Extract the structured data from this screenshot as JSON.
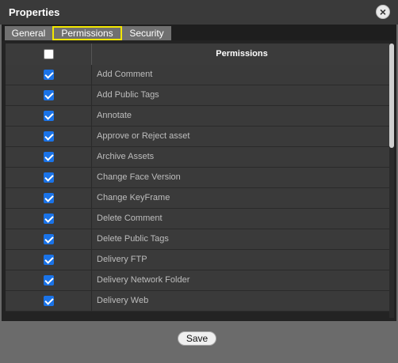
{
  "dialog": {
    "title": "Properties",
    "close_label": "×",
    "tabs": [
      {
        "label": "General"
      },
      {
        "label": "Permissions",
        "selected": true
      },
      {
        "label": "Security"
      }
    ]
  },
  "table": {
    "select_all_checked": false,
    "column_header": "Permissions",
    "rows": [
      {
        "label": "Add Comment",
        "checked": true
      },
      {
        "label": "Add Public Tags",
        "checked": true
      },
      {
        "label": "Annotate",
        "checked": true
      },
      {
        "label": "Approve or Reject asset",
        "checked": true
      },
      {
        "label": "Archive Assets",
        "checked": true
      },
      {
        "label": "Change Face Version",
        "checked": true
      },
      {
        "label": "Change KeyFrame",
        "checked": true
      },
      {
        "label": "Delete Comment",
        "checked": true
      },
      {
        "label": "Delete Public Tags",
        "checked": true
      },
      {
        "label": "Delivery FTP",
        "checked": true
      },
      {
        "label": "Delivery Network Folder",
        "checked": true
      },
      {
        "label": "Delivery Web",
        "checked": true
      }
    ]
  },
  "footer": {
    "save_label": "Save"
  },
  "colors": {
    "tab_highlight": "#f2e600",
    "checkbox_checked": "#1a73e8"
  }
}
